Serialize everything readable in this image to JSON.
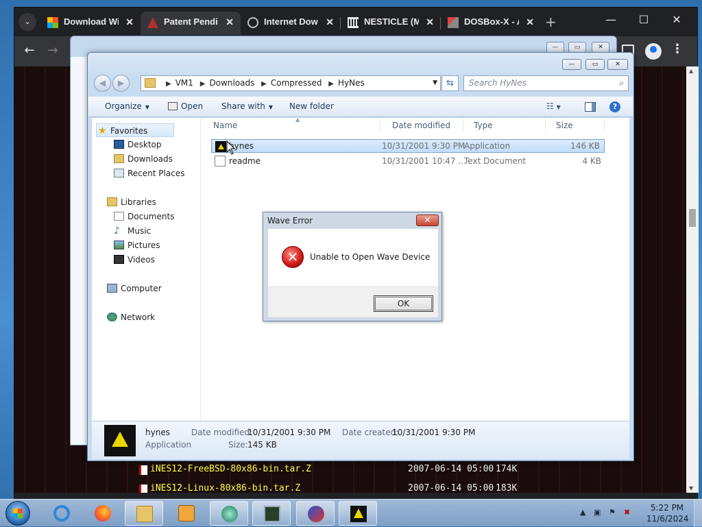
{
  "browser": {
    "tabs": [
      {
        "label": "Download Wi",
        "active": false
      },
      {
        "label": "Patent Pendi",
        "active": true
      },
      {
        "label": "Internet Dow",
        "active": false
      },
      {
        "label": "NESTICLE (M!",
        "active": false
      },
      {
        "label": "DOSBox-X - A",
        "active": false
      }
    ],
    "new_tab": "+",
    "tab_close": "✕",
    "tab_menu": "⌄",
    "win_min": "—",
    "win_max": "☐",
    "win_close": "✕",
    "back": "←",
    "forward": "→",
    "kebab": "⋮"
  },
  "page_listing": [
    {
      "name": "iNES12-FreeBSD-80x86-bin.tar.Z",
      "date": "2007-06-14 05:00",
      "size": "174K"
    },
    {
      "name": "iNES12-Linux-80x86-bin.tar.Z",
      "date": "2007-06-14 05:00",
      "size": "183K"
    }
  ],
  "explorer": {
    "address": [
      "VM1",
      "Downloads",
      "Compressed",
      "HyNes"
    ],
    "search_placeholder": "Search HyNes",
    "toolbar": {
      "organize": "Organize",
      "open": "Open",
      "share_with": "Share with",
      "new_folder": "New folder"
    },
    "nav": {
      "favorites": "Favorites",
      "desktop": "Desktop",
      "downloads": "Downloads",
      "recent": "Recent Places",
      "libraries": "Libraries",
      "documents": "Documents",
      "music": "Music",
      "pictures": "Pictures",
      "videos": "Videos",
      "computer": "Computer",
      "network": "Network"
    },
    "columns": {
      "name": "Name",
      "date": "Date modified",
      "type": "Type",
      "size": "Size"
    },
    "files": [
      {
        "name": "hynes",
        "date": "10/31/2001 9:30 PM",
        "type": "Application",
        "size": "146 KB",
        "selected": true
      },
      {
        "name": "readme",
        "date": "10/31/2001 10:47 ...",
        "type": "Text Document",
        "size": "4 KB",
        "selected": false
      }
    ],
    "details": {
      "name": "hynes",
      "kind": "Application",
      "modified_label": "Date modified:",
      "modified": "10/31/2001 9:30 PM",
      "created_label": "Date created:",
      "created": "10/31/2001 9:30 PM",
      "size_label": "Size:",
      "size": "145 KB"
    }
  },
  "dialog": {
    "title": "Wave Error",
    "message": "Unable to Open Wave Device",
    "ok": "OK",
    "close": "✕",
    "error_glyph": "✕"
  },
  "taskbar": {
    "time": "5:22 PM",
    "date": "11/6/2024"
  },
  "colors": {
    "accent": "#3a78b8",
    "error": "#d01818",
    "ftp_text": "#ffff44"
  }
}
